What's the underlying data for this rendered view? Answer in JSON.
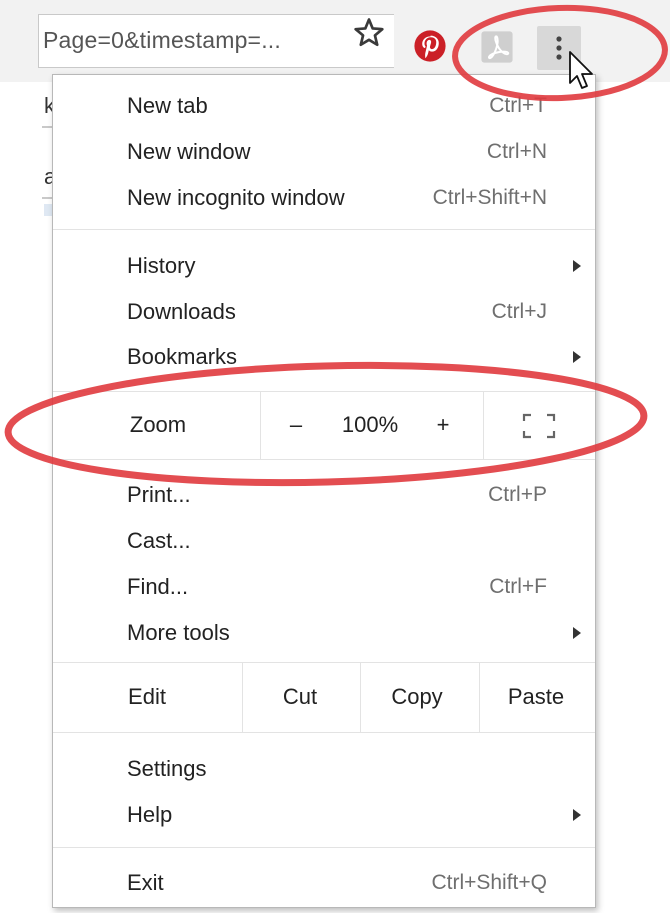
{
  "toolbar": {
    "url_text": "Page=0&timestamp=...",
    "icons": {
      "bookmark": "star-icon",
      "pinterest": "pinterest-icon",
      "pdf": "pdf-icon",
      "menu": "kebab-menu-icon"
    }
  },
  "page": {
    "fragment_1": "k",
    "fragment_2": "a"
  },
  "menu": {
    "new_tab": {
      "label": "New tab",
      "shortcut": "Ctrl+T"
    },
    "new_window": {
      "label": "New window",
      "shortcut": "Ctrl+N"
    },
    "new_incognito": {
      "label": "New incognito window",
      "shortcut": "Ctrl+Shift+N"
    },
    "history": {
      "label": "History"
    },
    "downloads": {
      "label": "Downloads",
      "shortcut": "Ctrl+J"
    },
    "bookmarks": {
      "label": "Bookmarks"
    },
    "zoom": {
      "label": "Zoom",
      "minus": "–",
      "level": "100%",
      "plus": "+"
    },
    "print": {
      "label": "Print...",
      "shortcut": "Ctrl+P"
    },
    "cast": {
      "label": "Cast..."
    },
    "find": {
      "label": "Find...",
      "shortcut": "Ctrl+F"
    },
    "more_tools": {
      "label": "More tools"
    },
    "edit": {
      "label": "Edit",
      "cut": "Cut",
      "copy": "Copy",
      "paste": "Paste"
    },
    "settings": {
      "label": "Settings"
    },
    "help": {
      "label": "Help"
    },
    "exit": {
      "label": "Exit",
      "shortcut": "Ctrl+Shift+Q"
    }
  },
  "colors": {
    "annotation": "#e03a3e",
    "pinterest": "#cb2027",
    "menu_button_bg": "#d8d8d8"
  }
}
